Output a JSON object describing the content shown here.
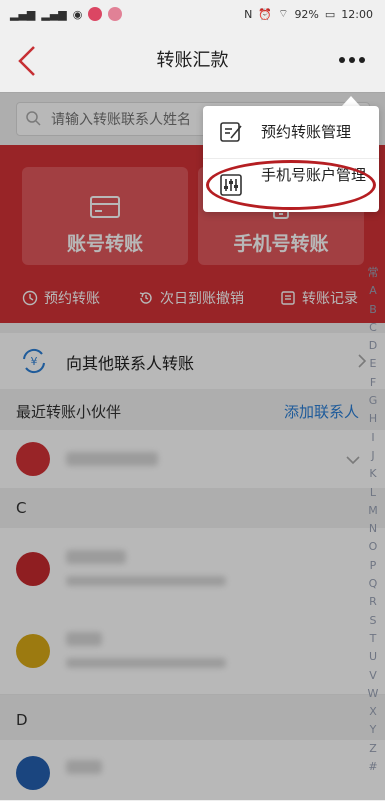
{
  "status_bar": {
    "battery": "92%",
    "time": "12:00"
  },
  "header": {
    "title": "转账汇款"
  },
  "search": {
    "placeholder": "请输入转账联系人姓名"
  },
  "cards": [
    {
      "label": "账号转账",
      "icon": "card-icon"
    },
    {
      "label": "手机号转账",
      "icon": "phone-icon"
    }
  ],
  "quick_actions": [
    {
      "label": "预约转账",
      "icon": "clock-icon"
    },
    {
      "label": "次日到账撤销",
      "icon": "undo-clock-icon"
    },
    {
      "label": "转账记录",
      "icon": "record-icon"
    }
  ],
  "other_contacts": {
    "label": "向其他联系人转账"
  },
  "recent": {
    "title": "最近转账小伙伴",
    "add_label": "添加联系人"
  },
  "sections": [
    {
      "letter": "C"
    },
    {
      "letter": "D"
    }
  ],
  "index_letters": [
    "常",
    "A",
    "B",
    "C",
    "D",
    "E",
    "F",
    "G",
    "H",
    "I",
    "J",
    "K",
    "L",
    "M",
    "N",
    "O",
    "P",
    "Q",
    "R",
    "S",
    "T",
    "U",
    "V",
    "W",
    "X",
    "Y",
    "Z",
    "#"
  ],
  "popup": {
    "items": [
      {
        "label": "预约转账管理",
        "icon": "edit-list-icon"
      },
      {
        "label": "手机号账户管理",
        "icon": "sliders-icon"
      }
    ]
  },
  "colors": {
    "brand_red": "#d33237",
    "link_blue": "#2b7fd6"
  }
}
